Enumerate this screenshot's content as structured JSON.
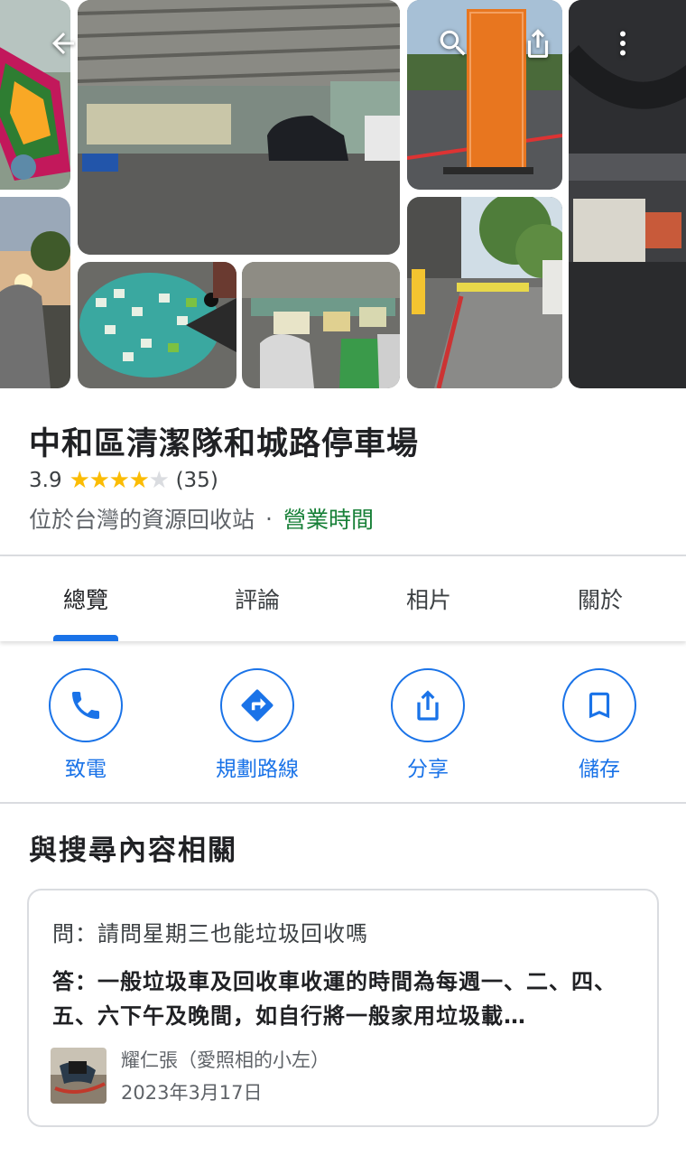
{
  "place": {
    "name": "中和區清潔隊和城路停車場",
    "rating": "3.9",
    "stars": 3.9,
    "review_count": "(35)",
    "category": "位於台灣的資源回收站",
    "separator": "·",
    "hours_link": "營業時間"
  },
  "tabs": [
    {
      "label": "總覽",
      "active": true
    },
    {
      "label": "評論",
      "active": false
    },
    {
      "label": "相片",
      "active": false
    },
    {
      "label": "關於",
      "active": false
    }
  ],
  "actions": [
    {
      "label": "致電",
      "icon": "phone-icon"
    },
    {
      "label": "規劃路線",
      "icon": "directions-icon"
    },
    {
      "label": "分享",
      "icon": "share-icon"
    },
    {
      "label": "儲存",
      "icon": "bookmark-icon"
    }
  ],
  "related": {
    "title": "與搜尋內容相關",
    "question": "問：請問星期三也能垃圾回收嗎",
    "answer": "答：一般垃圾車及回收車收運的時間為每週一、二、四、五、六下午及晚間，如自行將一般家用垃圾載…",
    "author": "耀仁張（愛照相的小左）",
    "date": "2023年3月17日"
  },
  "colors": {
    "accent": "#1a73e8",
    "star": "#fbbc04",
    "open_green": "#188038"
  }
}
